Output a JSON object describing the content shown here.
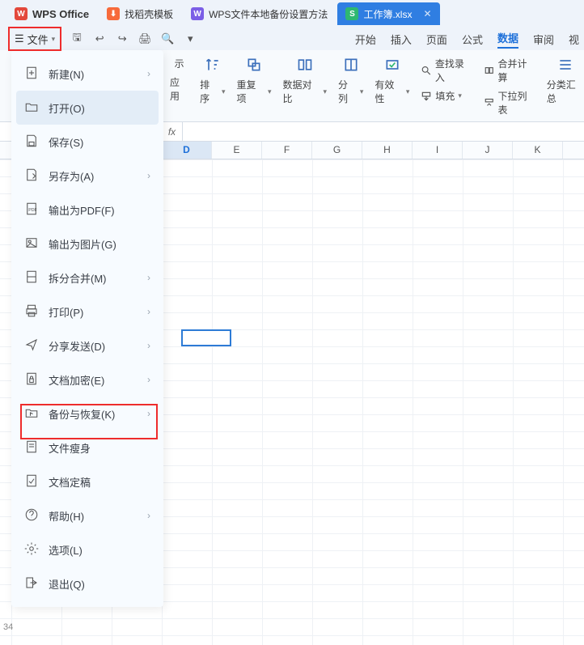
{
  "tabs": {
    "office": "WPS Office",
    "t1": "找稻壳模板",
    "t2": "WPS文件本地备份设置方法",
    "t3": "工作簿.xlsx",
    "t3_badge": "S"
  },
  "file_button": "文件",
  "menu_tabs": {
    "start": "开始",
    "insert": "插入",
    "page": "页面",
    "formula": "公式",
    "data": "数据",
    "review": "审阅",
    "view": "视"
  },
  "ribbon": {
    "sort": "排序",
    "dedupe": "重复项",
    "compare": "数据对比",
    "split": "分列",
    "validity": "有效性",
    "find_input": "查找录入",
    "merge_calc": "合并计算",
    "fill": "填充",
    "dropdown_list": "下拉列表",
    "category": "分类汇总",
    "apply_partial": "应用",
    "show_partial": "示"
  },
  "formula_fx": "fx",
  "columns": [
    "D",
    "E",
    "F",
    "G",
    "H",
    "I",
    "J",
    "K"
  ],
  "active_col_index": 0,
  "row_label_bottom": "34",
  "file_menu": [
    {
      "id": "new",
      "label": "新建(N)",
      "arrow": true
    },
    {
      "id": "open",
      "label": "打开(O)",
      "arrow": false
    },
    {
      "id": "save",
      "label": "保存(S)",
      "arrow": false
    },
    {
      "id": "saveas",
      "label": "另存为(A)",
      "arrow": true
    },
    {
      "id": "pdf",
      "label": "输出为PDF(F)",
      "arrow": false
    },
    {
      "id": "image",
      "label": "输出为图片(G)",
      "arrow": false
    },
    {
      "id": "split",
      "label": "拆分合并(M)",
      "arrow": true
    },
    {
      "id": "print",
      "label": "打印(P)",
      "arrow": true
    },
    {
      "id": "share",
      "label": "分享发送(D)",
      "arrow": true
    },
    {
      "id": "encrypt",
      "label": "文档加密(E)",
      "arrow": true
    },
    {
      "id": "backup",
      "label": "备份与恢复(K)",
      "arrow": true
    },
    {
      "id": "slim",
      "label": "文件瘦身",
      "arrow": false
    },
    {
      "id": "final",
      "label": "文档定稿",
      "arrow": false
    },
    {
      "id": "help",
      "label": "帮助(H)",
      "arrow": true
    },
    {
      "id": "options",
      "label": "选项(L)",
      "arrow": false
    },
    {
      "id": "exit",
      "label": "退出(Q)",
      "arrow": false
    }
  ]
}
